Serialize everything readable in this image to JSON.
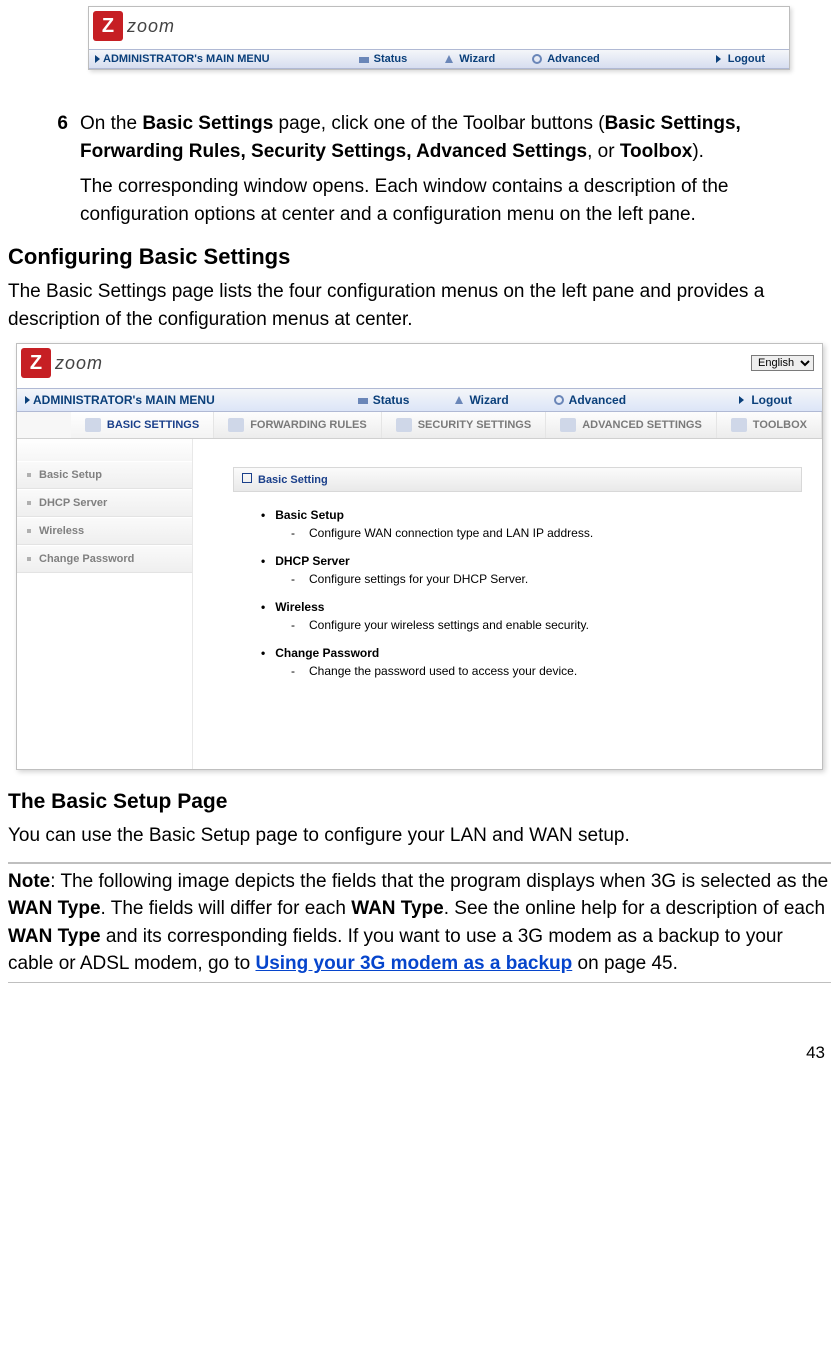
{
  "shot1": {
    "logo_text": "zoom",
    "menu_main": "ADMINISTRATOR's MAIN MENU",
    "menu_status": "Status",
    "menu_wizard": "Wizard",
    "menu_advanced": "Advanced",
    "menu_logout": "Logout"
  },
  "step6": {
    "num": "6",
    "text_pre": "On the ",
    "bs": "Basic Settings",
    "text_mid": " page, click one of the Toolbar buttons (",
    "list": "Basic Settings, Forwarding Rules, Security Settings, Advanced Settings",
    "text_or": ", or ",
    "toolbox": "Toolbox",
    "text_end": ").",
    "para2": "The corresponding window opens. Each window contains a description of the configuration options at center and a configuration menu on the left pane."
  },
  "heading_cfg": "Configuring Basic Settings",
  "para_cfg_pre": "The ",
  "para_cfg_bs": "Basic Settings",
  "para_cfg_post": " page lists the four configuration menus on the left pane and provides a description of the configuration menus at center.",
  "shot2": {
    "logo_text": "zoom",
    "lang_label": "English",
    "menu_main": "ADMINISTRATOR's MAIN MENU",
    "menu_status": "Status",
    "menu_wizard": "Wizard",
    "menu_advanced": "Advanced",
    "menu_logout": "Logout",
    "tabs": {
      "basic": "BASIC SETTINGS",
      "forwarding": "FORWARDING RULES",
      "security": "SECURITY SETTINGS",
      "advanced": "ADVANCED SETTINGS",
      "toolbox": "TOOLBOX"
    },
    "left": {
      "i0": "Basic Setup",
      "i1": "DHCP Server",
      "i2": "Wireless",
      "i3": "Change Password"
    },
    "panel_title": "Basic Setting",
    "desc": {
      "t0": "Basic Setup",
      "d0": "Configure WAN connection type and LAN IP address.",
      "t1": "DHCP Server",
      "d1": "Configure settings for your DHCP Server.",
      "t2": "Wireless",
      "d2": "Configure your wireless settings and enable security.",
      "t3": "Change Password",
      "d3": "Change the password used to access your device."
    }
  },
  "heading_bsp": "The Basic Setup Page",
  "para_bsp_pre": "You can use the ",
  "para_bsp_bs": "Basic Setup",
  "para_bsp_post": " page to configure your LAN and WAN setup.",
  "note": {
    "label": "Note",
    "t1": ": The following image depicts the fields that the program displays when 3G is selected as the ",
    "wt1": "WAN Type",
    "t2": ". The fields will differ for each ",
    "wt2": "WAN Type",
    "t3": ". See the online help for a description of each ",
    "wt3": "WAN Type",
    "t4": " and its corresponding fields. If you want to use a 3G modem as a backup to your cable or ADSL modem, go to ",
    "link": "Using your 3G modem as a backup",
    "t5": " on page 45."
  },
  "pagenum": "43"
}
